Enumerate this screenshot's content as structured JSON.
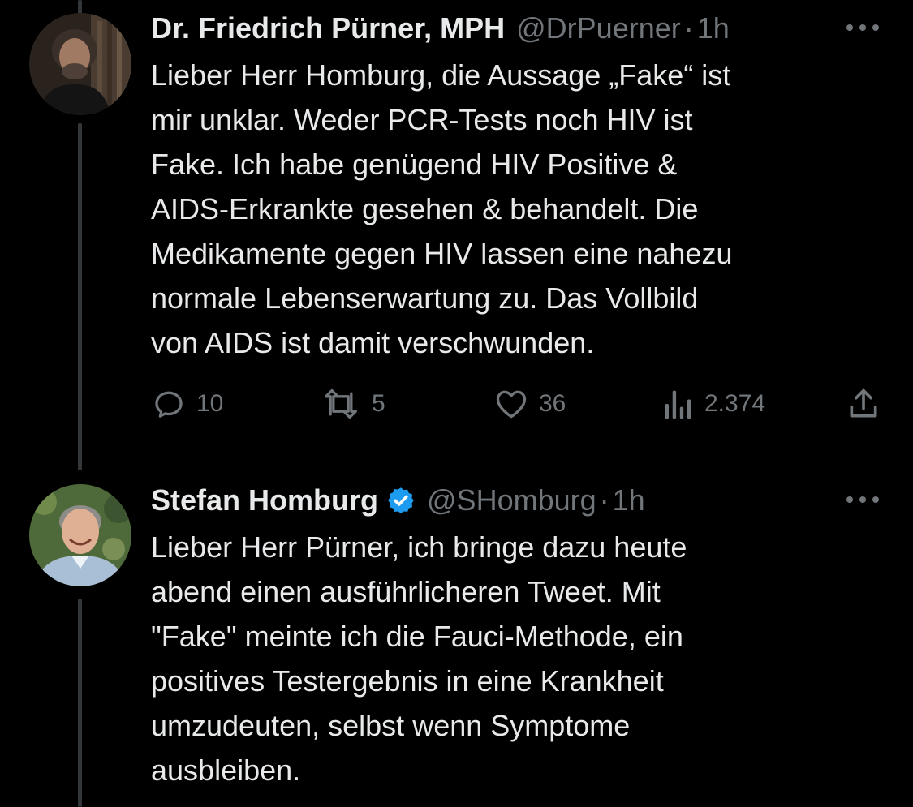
{
  "tweets": [
    {
      "display_name": "Dr. Friedrich Pürner, MPH",
      "handle": "@DrPuerner",
      "separator": "·",
      "time": "1h",
      "verified": false,
      "text": "Lieber Herr Homburg, die Aussage „Fake“ ist\nmir unklar. Weder PCR-Tests noch HIV ist\nFake. Ich habe genügend HIV Positive &\nAIDS-Erkrankte gesehen & behandelt. Die\nMedikamente gegen HIV lassen eine nahezu\nnormale Lebenserwartung zu. Das Vollbild\nvon AIDS ist damit verschwunden.",
      "actions": {
        "replies": "10",
        "retweets": "5",
        "likes": "36",
        "views": "2.374"
      },
      "avatar_icon": "avatar-bearded-man"
    },
    {
      "display_name": "Stefan Homburg",
      "handle": "@SHomburg",
      "separator": "·",
      "time": "1h",
      "verified": true,
      "text": "Lieber Herr Pürner, ich bringe dazu heute\nabend einen ausführlicheren Tweet. Mit\n\"Fake\" meinte ich die Fauci-Methode, ein\npositives Testergebnis in eine Krankheit\numzudeuten, selbst wenn Symptome\nausbleiben.",
      "avatar_icon": "avatar-smiling-man"
    }
  ],
  "colors": {
    "background": "#000000",
    "primary_text": "#e7e9ea",
    "secondary_text": "#71767b",
    "thread_line": "#333639",
    "verified_blue": "#1d9bf0"
  }
}
